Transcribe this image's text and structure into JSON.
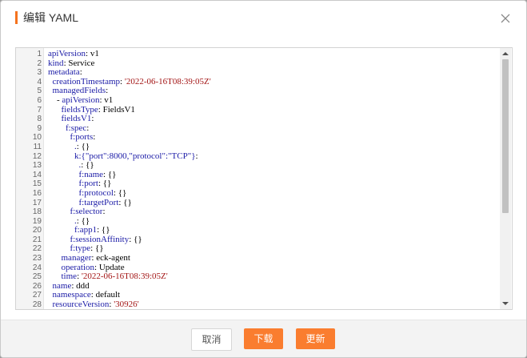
{
  "dialog": {
    "title": "编辑 YAML"
  },
  "editor": {
    "lines": [
      {
        "n": "1",
        "indent": "",
        "key": "apiVersion",
        "sep": ": ",
        "val": "v1",
        "cls": "v"
      },
      {
        "n": "2",
        "indent": "",
        "key": "kind",
        "sep": ": ",
        "val": "Service",
        "cls": "v"
      },
      {
        "n": "3",
        "indent": "",
        "key": "metadata",
        "sep": ":",
        "val": "",
        "cls": "v"
      },
      {
        "n": "4",
        "indent": "  ",
        "key": "creationTimestamp",
        "sep": ": ",
        "val": "'2022-06-16T08:39:05Z'",
        "cls": "s"
      },
      {
        "n": "5",
        "indent": "  ",
        "key": "managedFields",
        "sep": ":",
        "val": "",
        "cls": "v"
      },
      {
        "n": "6",
        "indent": "    - ",
        "key": "apiVersion",
        "sep": ": ",
        "val": "v1",
        "cls": "v"
      },
      {
        "n": "7",
        "indent": "      ",
        "key": "fieldsType",
        "sep": ": ",
        "val": "FieldsV1",
        "cls": "v"
      },
      {
        "n": "8",
        "indent": "      ",
        "key": "fieldsV1",
        "sep": ":",
        "val": "",
        "cls": "v"
      },
      {
        "n": "9",
        "indent": "        ",
        "key": "f:spec",
        "sep": ":",
        "val": "",
        "cls": "v"
      },
      {
        "n": "10",
        "indent": "          ",
        "key": "f:ports",
        "sep": ":",
        "val": "",
        "cls": "v"
      },
      {
        "n": "11",
        "indent": "            ",
        "key": ".",
        "sep": ": ",
        "val": "{}",
        "cls": "v"
      },
      {
        "n": "12",
        "indent": "            ",
        "key": "k:{\"port\":8000,\"protocol\":\"TCP\"}",
        "sep": ":",
        "val": "",
        "cls": "v"
      },
      {
        "n": "13",
        "indent": "              ",
        "key": ".",
        "sep": ": ",
        "val": "{}",
        "cls": "v"
      },
      {
        "n": "14",
        "indent": "              ",
        "key": "f:name",
        "sep": ": ",
        "val": "{}",
        "cls": "v"
      },
      {
        "n": "15",
        "indent": "              ",
        "key": "f:port",
        "sep": ": ",
        "val": "{}",
        "cls": "v"
      },
      {
        "n": "16",
        "indent": "              ",
        "key": "f:protocol",
        "sep": ": ",
        "val": "{}",
        "cls": "v"
      },
      {
        "n": "17",
        "indent": "              ",
        "key": "f:targetPort",
        "sep": ": ",
        "val": "{}",
        "cls": "v"
      },
      {
        "n": "18",
        "indent": "          ",
        "key": "f:selector",
        "sep": ":",
        "val": "",
        "cls": "v"
      },
      {
        "n": "19",
        "indent": "            ",
        "key": ".",
        "sep": ": ",
        "val": "{}",
        "cls": "v"
      },
      {
        "n": "20",
        "indent": "            ",
        "key": "f:app1",
        "sep": ": ",
        "val": "{}",
        "cls": "v"
      },
      {
        "n": "21",
        "indent": "          ",
        "key": "f:sessionAffinity",
        "sep": ": ",
        "val": "{}",
        "cls": "v"
      },
      {
        "n": "22",
        "indent": "          ",
        "key": "f:type",
        "sep": ": ",
        "val": "{}",
        "cls": "v"
      },
      {
        "n": "23",
        "indent": "      ",
        "key": "manager",
        "sep": ": ",
        "val": "eck-agent",
        "cls": "v"
      },
      {
        "n": "24",
        "indent": "      ",
        "key": "operation",
        "sep": ": ",
        "val": "Update",
        "cls": "v"
      },
      {
        "n": "25",
        "indent": "      ",
        "key": "time",
        "sep": ": ",
        "val": "'2022-06-16T08:39:05Z'",
        "cls": "s"
      },
      {
        "n": "26",
        "indent": "  ",
        "key": "name",
        "sep": ": ",
        "val": "ddd",
        "cls": "v"
      },
      {
        "n": "27",
        "indent": "  ",
        "key": "namespace",
        "sep": ": ",
        "val": "default",
        "cls": "v"
      },
      {
        "n": "28",
        "indent": "  ",
        "key": "resourceVersion",
        "sep": ": ",
        "val": "'30926'",
        "cls": "s"
      }
    ]
  },
  "footer": {
    "cancel_label": "取消",
    "download_label": "下载",
    "update_label": "更新"
  },
  "colors": {
    "accent": "#fa7d2f",
    "key": "#1a1aa6",
    "string": "#a31515"
  },
  "icons": {
    "close": "close-icon",
    "scroll_up": "scroll-up-icon",
    "scroll_down": "scroll-down-icon"
  }
}
